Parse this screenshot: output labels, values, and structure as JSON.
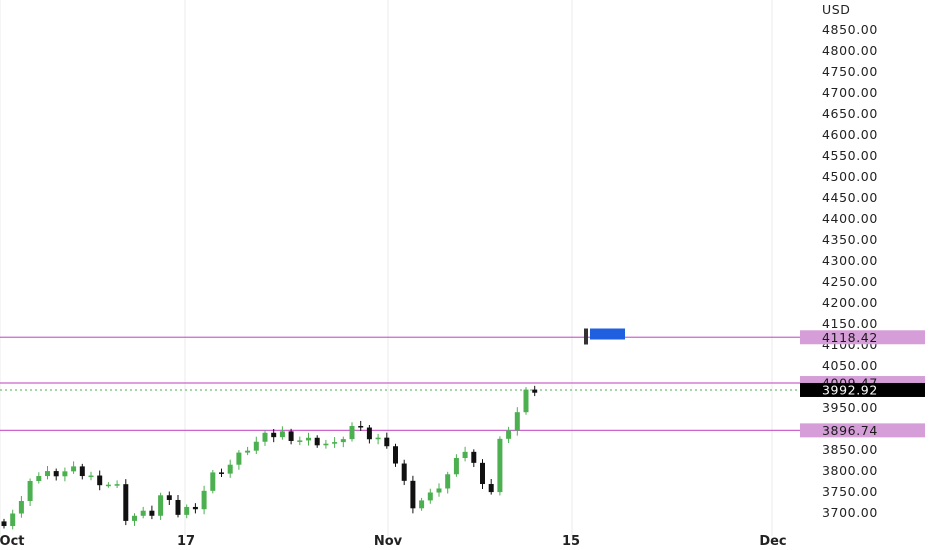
{
  "chart_data": {
    "type": "candlestick",
    "currency": "USD",
    "y_range": [
      3675,
      4875
    ],
    "y_ticks": [
      "4850.00",
      "4800.00",
      "4750.00",
      "4700.00",
      "4650.00",
      "4600.00",
      "4550.00",
      "4500.00",
      "4450.00",
      "4400.00",
      "4350.00",
      "4300.00",
      "4250.00",
      "4200.00",
      "4150.00",
      "4100.00",
      "4050.00",
      "4000.00",
      "3950.00",
      "3900.00",
      "3850.00",
      "3800.00",
      "3750.00",
      "3700.00"
    ],
    "x_labels": [
      {
        "label": "Oct",
        "index": 0
      },
      {
        "label": "17",
        "index": 14
      },
      {
        "label": "Nov",
        "index": 26
      },
      {
        "label": "15",
        "index": 35
      },
      {
        "label": "Dec",
        "index": 47
      }
    ],
    "horizontal_levels": [
      {
        "price": 4118.42,
        "label": "4118.42",
        "color": "#cc66cc"
      },
      {
        "price": 4009.47,
        "label": "4009.47",
        "color": "#cc66cc"
      },
      {
        "price": 3896.74,
        "label": "3896.74",
        "color": "#cc66cc"
      }
    ],
    "last_price": {
      "price": 3992.92,
      "label": "3992.92"
    },
    "marker_flag": {
      "price": 4125,
      "color": "#1f5fe0"
    },
    "candles": [
      {
        "o": 3680,
        "h": 3705,
        "l": 3672,
        "c": 3700
      },
      {
        "o": 3700,
        "h": 3720,
        "l": 3692,
        "c": 3712
      },
      {
        "o": 3712,
        "h": 3730,
        "l": 3705,
        "c": 3722
      },
      {
        "o": 3770,
        "h": 3800,
        "l": 3760,
        "c": 3790
      },
      {
        "o": 3790,
        "h": 3805,
        "l": 3775,
        "c": 3782
      },
      {
        "o": 3782,
        "h": 3795,
        "l": 3768,
        "c": 3774
      },
      {
        "o": 3774,
        "h": 3792,
        "l": 3766,
        "c": 3786
      },
      {
        "o": 3786,
        "h": 3802,
        "l": 3778,
        "c": 3795
      },
      {
        "o": 3795,
        "h": 3810,
        "l": 3784,
        "c": 3800
      },
      {
        "o": 3800,
        "h": 3812,
        "l": 3788,
        "c": 3792
      },
      {
        "o": 3792,
        "h": 3800,
        "l": 3776,
        "c": 3780
      },
      {
        "o": 3780,
        "h": 3788,
        "l": 3764,
        "c": 3770
      },
      {
        "o": 3770,
        "h": 3780,
        "l": 3758,
        "c": 3765
      },
      {
        "o": 3770,
        "h": 3781,
        "l": 3755,
        "c": 3760
      }
    ]
  }
}
